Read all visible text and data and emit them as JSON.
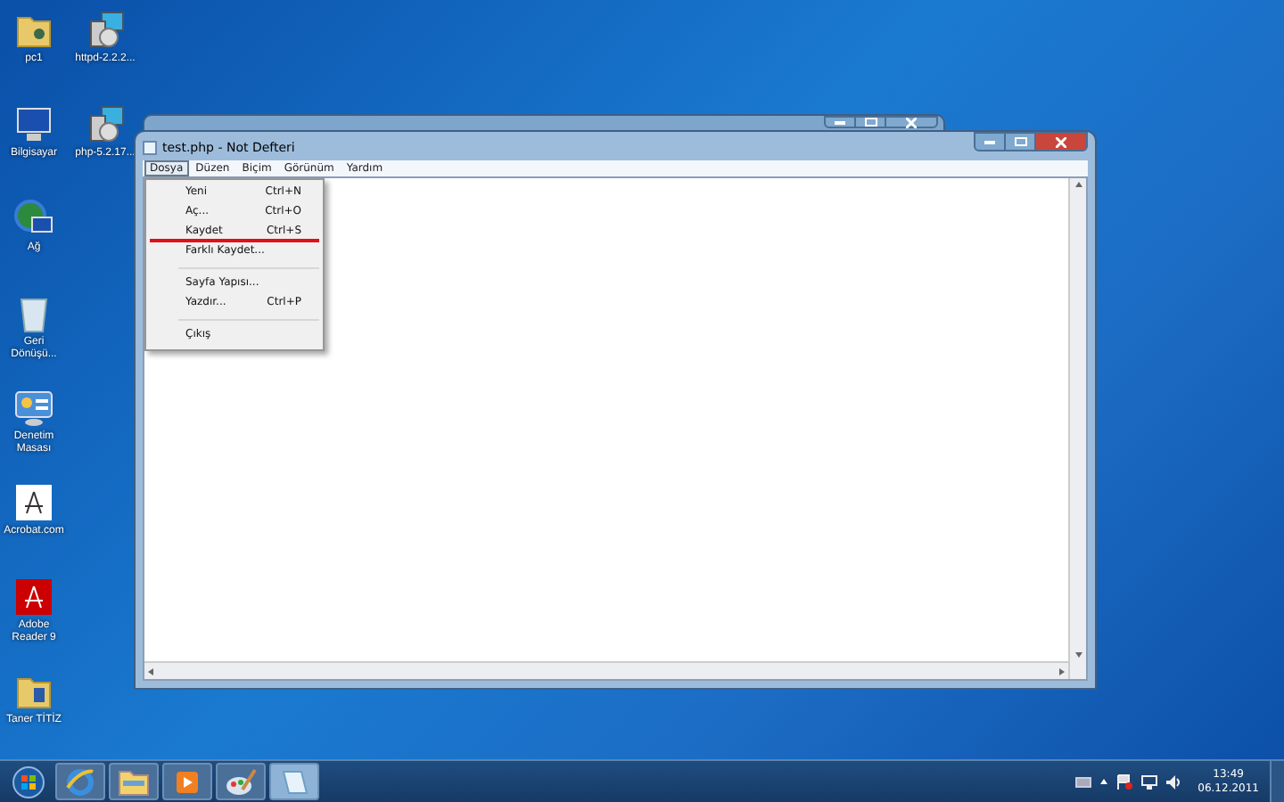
{
  "desktop_icon_columns": [
    [
      {
        "label": "pc1",
        "kind": "folder-user"
      },
      {
        "label": "Bilgisayar",
        "kind": "computer"
      },
      {
        "label": "Ağ",
        "kind": "network"
      },
      {
        "label": "Geri Dönüşü...",
        "kind": "recycle"
      },
      {
        "label": "Denetim Masası",
        "kind": "control-panel"
      },
      {
        "label": "Acrobat.com",
        "kind": "acrobat"
      },
      {
        "label": "Adobe Reader 9",
        "kind": "reader"
      },
      {
        "label": "Taner TİTİZ",
        "kind": "folder"
      }
    ],
    [
      {
        "label": "httpd-2.2.2...",
        "kind": "installer"
      },
      {
        "label": "php-5.2.17...",
        "kind": "installer"
      }
    ]
  ],
  "window": {
    "title": "test.php - Not Defteri",
    "menu_bar": [
      {
        "label": "Dosya",
        "selected": true
      },
      {
        "label": "Düzen",
        "selected": false
      },
      {
        "label": "Biçim",
        "selected": false
      },
      {
        "label": "Görünüm",
        "selected": false
      },
      {
        "label": "Yardım",
        "selected": false
      }
    ],
    "menu": [
      [
        {
          "label": "Yeni",
          "shortcut": "Ctrl+N",
          "underlined": false
        },
        {
          "label": "Aç...",
          "shortcut": "Ctrl+O",
          "underlined": false
        },
        {
          "label": "Kaydet",
          "shortcut": "Ctrl+S",
          "underlined": true
        },
        {
          "label": "Farklı Kaydet...",
          "underlined": false
        }
      ],
      [
        {
          "label": "Sayfa Yapısı...",
          "underlined": false
        },
        {
          "label": "Yazdır...",
          "shortcut": "Ctrl+P",
          "underlined": false
        }
      ],
      [
        {
          "label": "Çıkış",
          "underlined": false
        }
      ]
    ]
  },
  "taskbar": {
    "apps": [
      {
        "kind": "ie",
        "selected": false
      },
      {
        "kind": "explorer",
        "selected": false
      },
      {
        "kind": "media",
        "selected": false
      },
      {
        "kind": "paint",
        "selected": false
      },
      {
        "kind": "notepad",
        "selected": true
      }
    ],
    "time": "13:49",
    "date": "06.12.2011"
  }
}
